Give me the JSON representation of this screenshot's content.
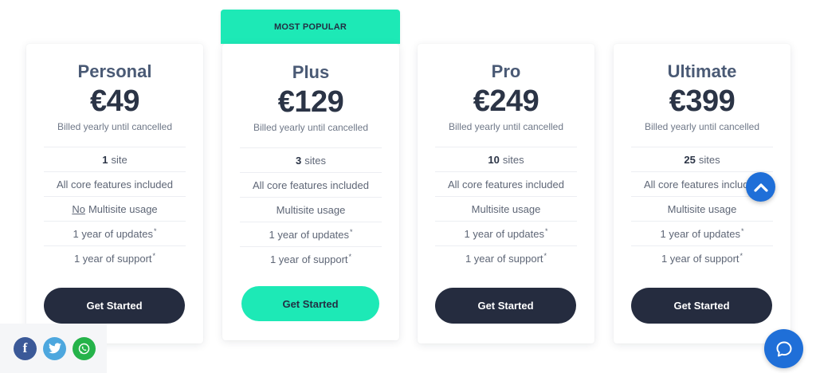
{
  "badge": {
    "label": "MOST POPULAR"
  },
  "plans": [
    {
      "name": "Personal",
      "price": "€49",
      "billing": "Billed yearly until cancelled",
      "features": [
        {
          "strong": "1",
          "text": "site"
        },
        {
          "text": "All core features included"
        },
        {
          "underline": "No",
          "text": "Multisite usage"
        },
        {
          "text": "1 year of updates",
          "sup": "*"
        },
        {
          "text": "1 year of support",
          "sup": "*"
        }
      ],
      "cta": "Get Started"
    },
    {
      "name": "Plus",
      "price": "€129",
      "billing": "Billed yearly until cancelled",
      "features": [
        {
          "strong": "3",
          "text": "sites"
        },
        {
          "text": "All core features included"
        },
        {
          "text": "Multisite usage"
        },
        {
          "text": "1 year of updates",
          "sup": "*"
        },
        {
          "text": "1 year of support",
          "sup": "*"
        }
      ],
      "cta": "Get Started"
    },
    {
      "name": "Pro",
      "price": "€249",
      "billing": "Billed yearly until cancelled",
      "features": [
        {
          "strong": "10",
          "text": "sites"
        },
        {
          "text": "All core features included"
        },
        {
          "text": "Multisite usage"
        },
        {
          "text": "1 year of updates",
          "sup": "*"
        },
        {
          "text": "1 year of support",
          "sup": "*"
        }
      ],
      "cta": "Get Started"
    },
    {
      "name": "Ultimate",
      "price": "€399",
      "billing": "Billed yearly until cancelled",
      "features": [
        {
          "strong": "25",
          "text": "sites"
        },
        {
          "text": "All core features included"
        },
        {
          "text": "Multisite usage"
        },
        {
          "text": "1 year of updates",
          "sup": "*"
        },
        {
          "text": "1 year of support",
          "sup": "*"
        }
      ],
      "cta": "Get Started"
    }
  ],
  "share": {
    "buttons": [
      {
        "icon": "facebook-icon",
        "glyph": "f",
        "color": "#3b5998"
      },
      {
        "icon": "twitter-icon",
        "color": "#4da7de"
      },
      {
        "icon": "whatsapp-icon",
        "color": "#25b34a"
      }
    ]
  },
  "widgets": {
    "scroll_top_icon": "chevron-up-icon",
    "chat_icon": "chat-bubble-icon",
    "accent_color": "#1f6fd8",
    "highlight_color": "#1de9b6",
    "dark_button_color": "#252c3f"
  }
}
